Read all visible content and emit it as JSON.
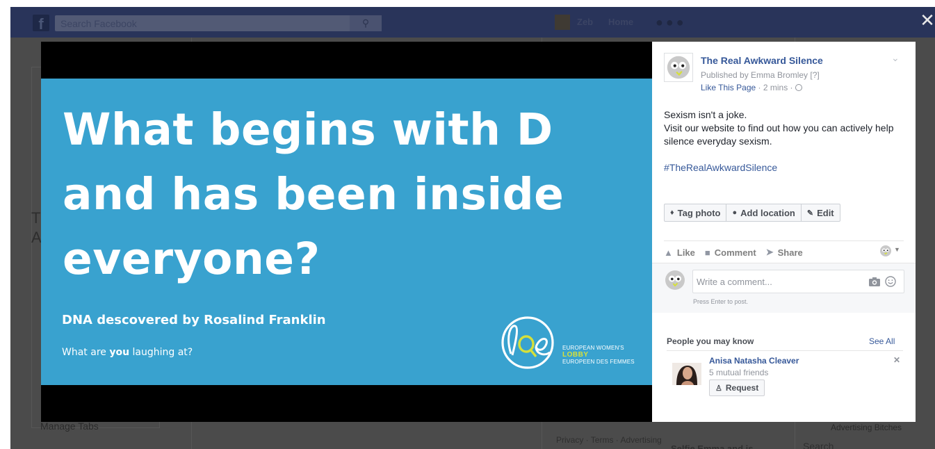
{
  "background": {
    "search_placeholder": "Search Facebook",
    "nav_user": "Zeb",
    "nav_home": "Home",
    "manage_tabs": "Manage Tabs",
    "footer_links": "Privacy · Terms · Advertising",
    "ad_text": "Advertising Bitches",
    "right_search": "Search",
    "below_text": "Selfie Emma and is"
  },
  "photo": {
    "headline_lines": [
      "What begins with D",
      "and has been inside",
      "everyone?"
    ],
    "subhead": "DNA descovered by Rosalind Franklin",
    "tagline_pre": "What are ",
    "tagline_bold": "you",
    "tagline_post": " laughing at?",
    "logo": {
      "line1": "EUROPEAN WOMEN'S",
      "line2": "LOBBY",
      "line3": "EUROPEEN DES FEMMES"
    },
    "colors": {
      "background": "#39a2cf",
      "accent": "#d6e03a"
    }
  },
  "post": {
    "page_name": "The Real Awkward Silence",
    "published_by": "Published by Emma Bromley",
    "published_help": "[?]",
    "like_page": "Like This Page",
    "time": "2 mins",
    "text_lines": [
      "Sexism isn't a joke.",
      "Visit our website to find out how you can actively help silence everyday sexism."
    ],
    "hashtag": "#TheRealAwkwardSilence",
    "photo_actions": [
      {
        "label": "Tag photo",
        "icon": "tag-icon"
      },
      {
        "label": "Add location",
        "icon": "location-pin-icon"
      },
      {
        "label": "Edit",
        "icon": "pencil-icon"
      }
    ],
    "reactions": [
      {
        "label": "Like",
        "icon": "thumbs-up-icon"
      },
      {
        "label": "Comment",
        "icon": "comment-icon"
      },
      {
        "label": "Share",
        "icon": "share-icon"
      }
    ],
    "comment": {
      "placeholder": "Write a comment...",
      "hint": "Press Enter to post."
    },
    "people_you_may_know": {
      "title": "People you may know",
      "see_all": "See All",
      "person": {
        "name": "Anisa Natasha Cleaver",
        "mutual": "5 mutual friends",
        "request_label": "Request"
      }
    }
  }
}
